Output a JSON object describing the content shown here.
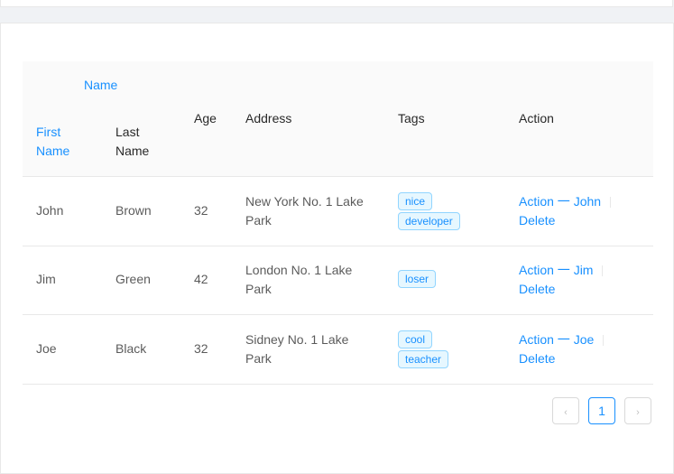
{
  "header": {
    "name": "Name",
    "first_name_line1": "First",
    "first_name_line2": "Name",
    "last_name_line1": "Last",
    "last_name_line2": "Name",
    "age": "Age",
    "address": "Address",
    "tags": "Tags",
    "action": "Action"
  },
  "rows": [
    {
      "first": "John",
      "last": "Brown",
      "age": "32",
      "address_line1": "New York No. 1 Lake",
      "address_line2": "Park",
      "tags": [
        "nice",
        "developer"
      ],
      "action": "Action 一 John",
      "delete": "Delete"
    },
    {
      "first": "Jim",
      "last": "Green",
      "age": "42",
      "address_line1": "London No. 1 Lake",
      "address_line2": "Park",
      "tags": [
        "loser"
      ],
      "action": "Action 一 Jim",
      "delete": "Delete"
    },
    {
      "first": "Joe",
      "last": "Black",
      "age": "32",
      "address_line1": "Sidney No. 1 Lake",
      "address_line2": "Park",
      "tags": [
        "cool",
        "teacher"
      ],
      "action": "Action 一 Joe",
      "delete": "Delete"
    }
  ],
  "pagination": {
    "current_page": "1",
    "prev_icon": "chevron-left-icon",
    "next_icon": "chevron-right-icon"
  },
  "colors": {
    "primary": "#1890ff",
    "tag_bg": "#e6f7ff",
    "tag_border": "#91d5ff"
  }
}
